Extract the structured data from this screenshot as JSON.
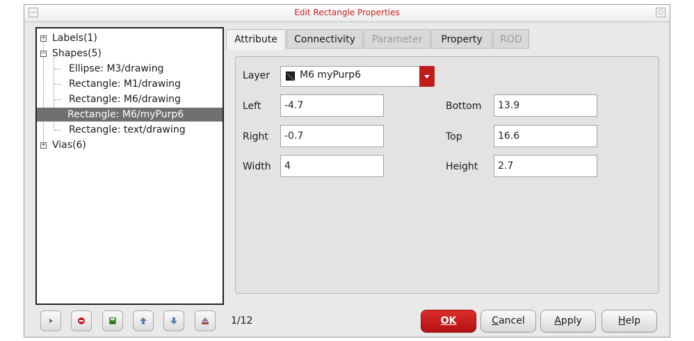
{
  "window": {
    "title": "Edit Rectangle Properties"
  },
  "tree": {
    "labels": "Labels",
    "labels_count": "(1)",
    "shapes": "Shapes",
    "shapes_count": "(5)",
    "items": [
      "Ellipse: M3/drawing",
      "Rectangle: M1/drawing",
      "Rectangle: M6/drawing",
      "Rectangle: M6/myPurp6",
      "Rectangle: text/drawing"
    ],
    "selected_index": 3,
    "vias": "Vias",
    "vias_count": "(6)"
  },
  "tabs": [
    {
      "label": "Attribute",
      "state": "active"
    },
    {
      "label": "Connectivity",
      "state": "normal"
    },
    {
      "label": "Parameter",
      "state": "disabled"
    },
    {
      "label": "Property",
      "state": "normal"
    },
    {
      "label": "ROD",
      "state": "disabled"
    }
  ],
  "attribute": {
    "layer_label": "Layer",
    "layer_value": "M6 myPurp6",
    "left_label": "Left",
    "left_value": "-4.7",
    "bottom_label": "Bottom",
    "bottom_value": "13.9",
    "right_label": "Right",
    "right_value": "-0.7",
    "top_label": "Top",
    "top_value": "16.6",
    "width_label": "Width",
    "width_value": "4",
    "height_label": "Height",
    "height_value": "2.7"
  },
  "footer": {
    "toolbar_icons": [
      "play-icon",
      "stop-icon",
      "save-icon",
      "arrow-up-icon",
      "arrow-down-icon",
      "eject-icon"
    ],
    "counter": "1/12",
    "ok_label": "OK",
    "cancel_first": "C",
    "cancel_rest": "ancel",
    "apply_first": "A",
    "apply_rest": "pply",
    "help_first": "H",
    "help_rest": "elp"
  },
  "colors": {
    "accent_red": "#c31a1a",
    "title_red": "#cc1f1f",
    "selection_gray": "#707070"
  }
}
